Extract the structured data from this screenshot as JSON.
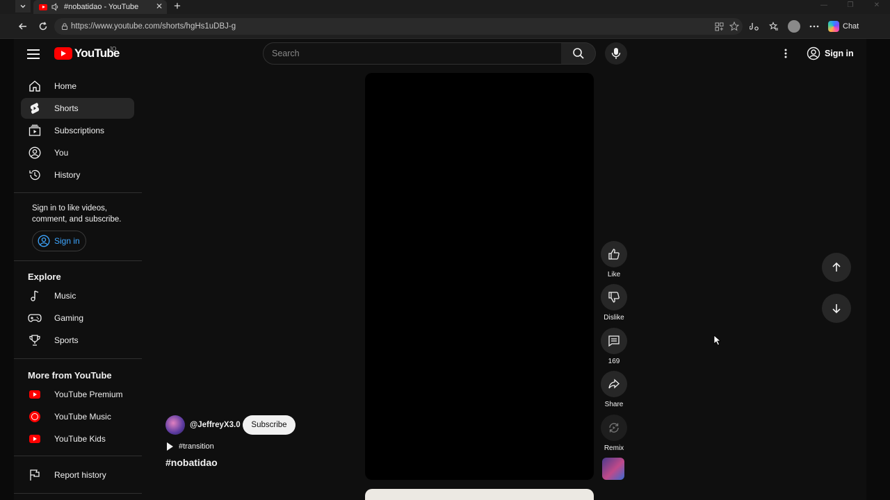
{
  "browser": {
    "tab_title": "#nobatidao - YouTube",
    "url": "https://www.youtube.com/shorts/hgHs1uDBJ-g",
    "chat_label": "Chat"
  },
  "masthead": {
    "logo_text": "YouTube",
    "country_code": "JO",
    "search_placeholder": "Search",
    "signin_label": "Sign in"
  },
  "sidebar": {
    "items": [
      {
        "label": "Home",
        "icon": "home-icon"
      },
      {
        "label": "Shorts",
        "icon": "shorts-icon",
        "active": true
      },
      {
        "label": "Subscriptions",
        "icon": "subscriptions-icon"
      },
      {
        "label": "You",
        "icon": "you-icon"
      },
      {
        "label": "History",
        "icon": "history-icon"
      }
    ],
    "signin_prompt": "Sign in to like videos, comment, and subscribe.",
    "signin_label": "Sign in",
    "explore_heading": "Explore",
    "explore": [
      {
        "label": "Music",
        "icon": "music-icon"
      },
      {
        "label": "Gaming",
        "icon": "gaming-icon"
      },
      {
        "label": "Sports",
        "icon": "trophy-icon"
      }
    ],
    "more_heading": "More from YouTube",
    "more": [
      {
        "label": "YouTube Premium",
        "icon": "youtube-premium-icon"
      },
      {
        "label": "YouTube Music",
        "icon": "youtube-music-icon"
      },
      {
        "label": "YouTube Kids",
        "icon": "youtube-kids-icon"
      }
    ],
    "report_history": "Report history"
  },
  "short": {
    "channel": "@JeffreyX3.0",
    "subscribe_label": "Subscribe",
    "sound_tag": "#transition",
    "title": "#nobatidao",
    "actions": {
      "like": "Like",
      "dislike": "Dislike",
      "comments": "169",
      "share": "Share",
      "remix": "Remix"
    }
  },
  "colors": {
    "accent": "#ff0000",
    "link": "#3ea6ff",
    "background": "#0f0f0f"
  }
}
